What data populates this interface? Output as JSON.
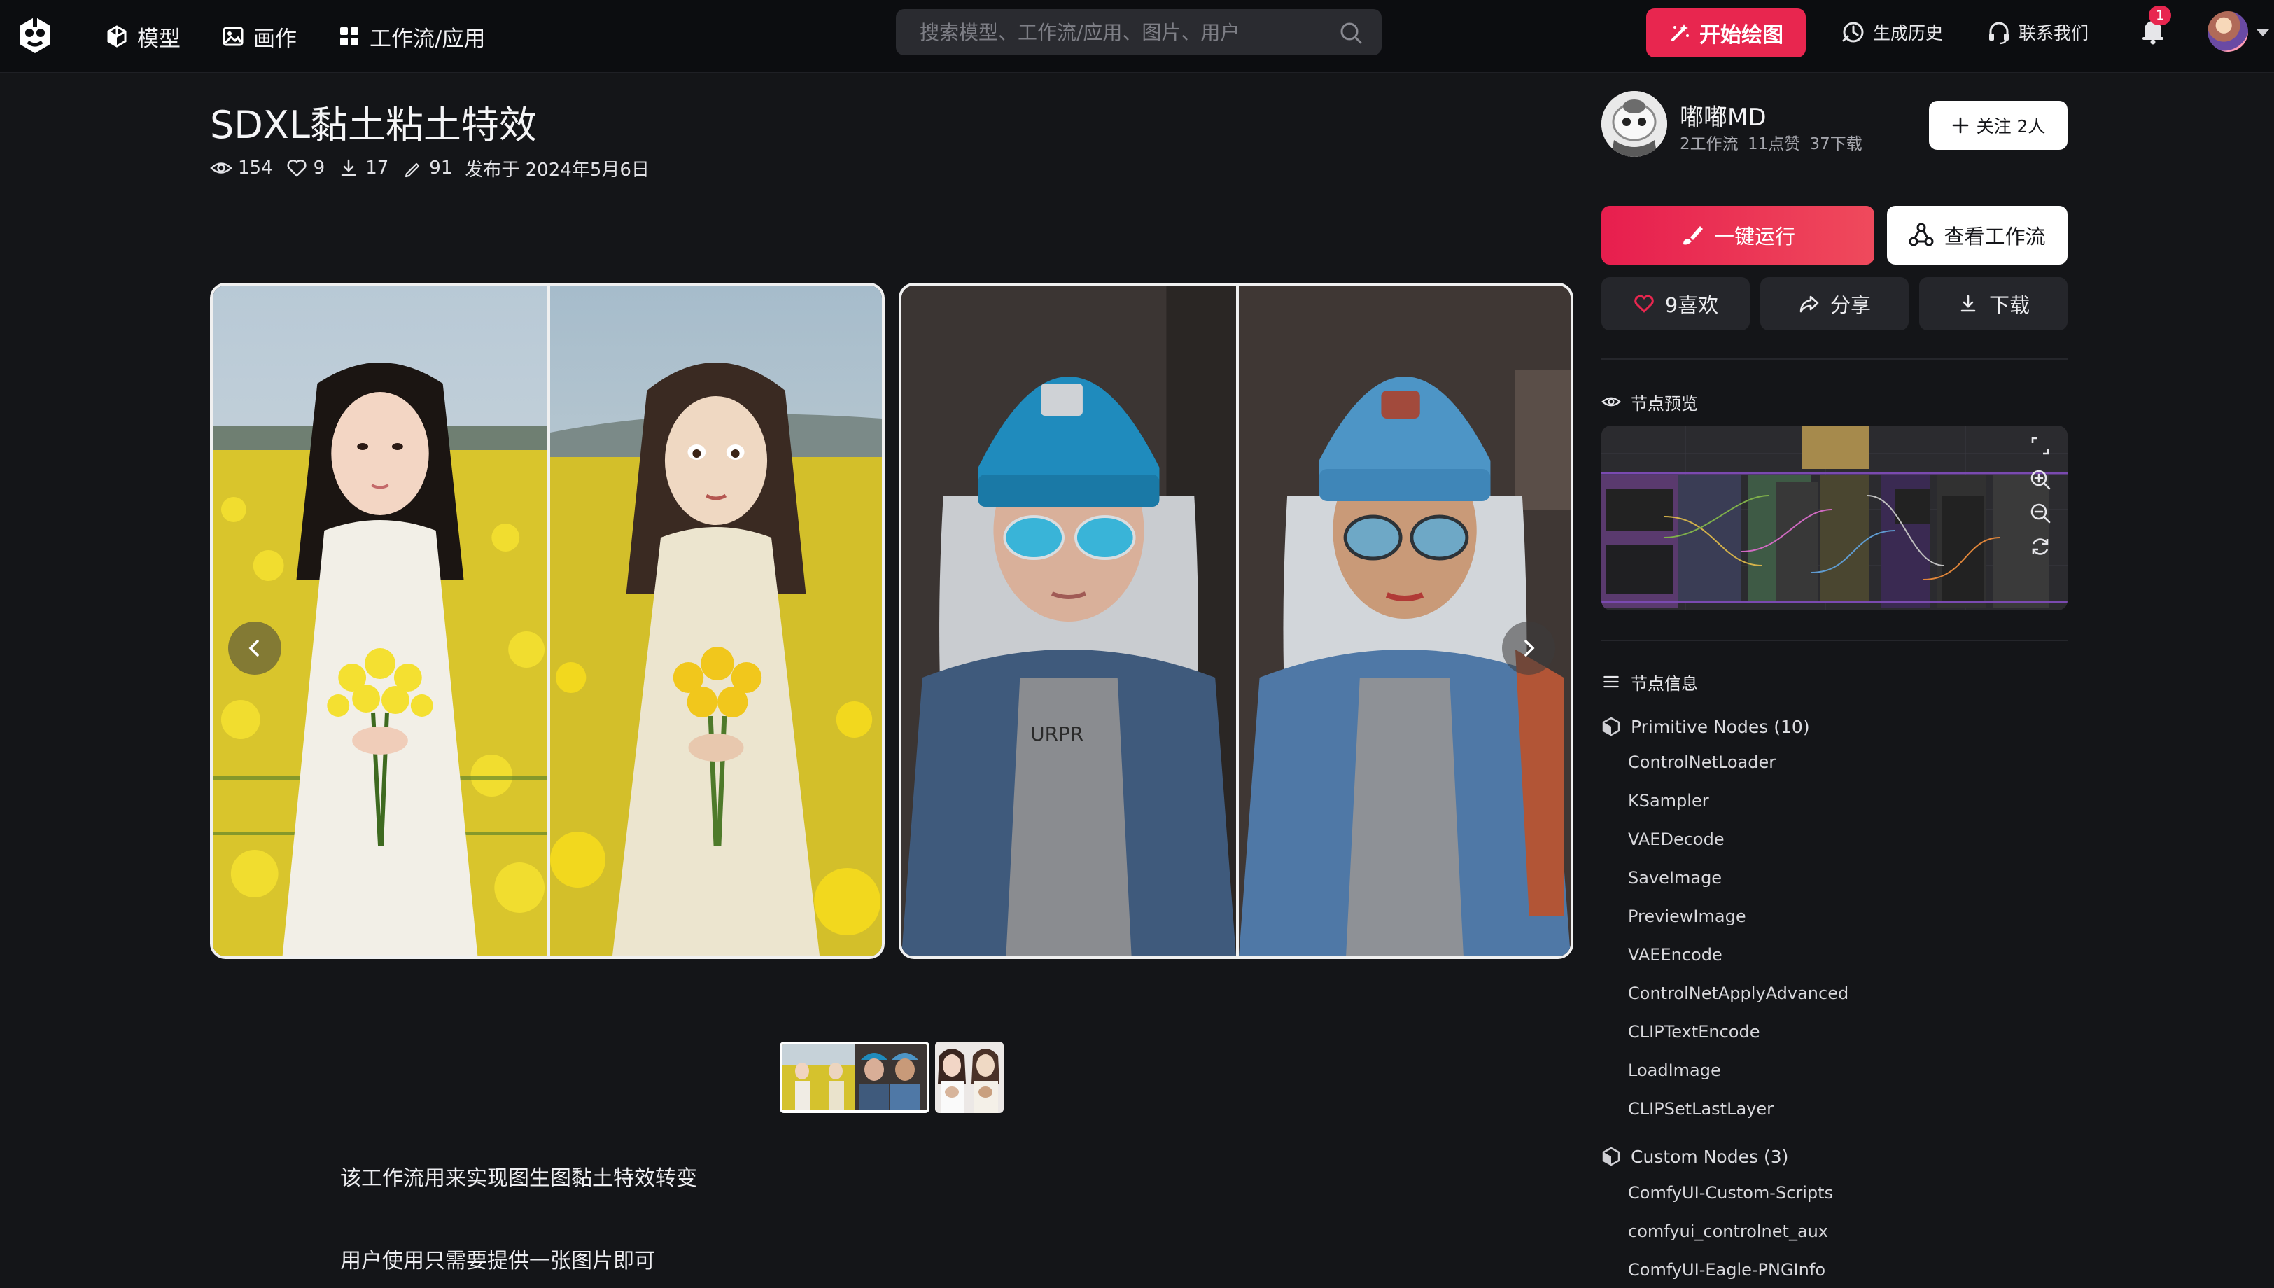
{
  "nav": {
    "items": [
      {
        "label": "模型",
        "icon": "cube-icon"
      },
      {
        "label": "画作",
        "icon": "image-icon"
      },
      {
        "label": "工作流/应用",
        "icon": "grid-icon"
      }
    ],
    "search_placeholder": "搜索模型、工作流/应用、图片、用户",
    "start_label": "开始绘图",
    "history_label": "生成历史",
    "contact_label": "联系我们",
    "notification_count": "1"
  },
  "workflow": {
    "title": "SDXL黏土粘土特效",
    "views": "154",
    "likes": "9",
    "downloads": "17",
    "runs": "91",
    "published": "发布于 2024年5月6日",
    "description": [
      "该工作流用来实现图生图黏土特效转变",
      "用户使用只需要提供一张图片即可"
    ]
  },
  "author": {
    "name": "嘟嘟MD",
    "stats": "2工作流 11点赞 37下载",
    "follow_label": "关注 2人"
  },
  "actions": {
    "run_label": "一键运行",
    "view_label": "查看工作流",
    "like_label": "9喜欢",
    "share_label": "分享",
    "download_label": "下载"
  },
  "node_preview_title": "节点预览",
  "node_info_title": "节点信息",
  "node_groups": [
    {
      "title": "Primitive Nodes (10)",
      "items": [
        "ControlNetLoader",
        "KSampler",
        "VAEDecode",
        "SaveImage",
        "PreviewImage",
        "VAEEncode",
        "ControlNetApplyAdvanced",
        "CLIPTextEncode",
        "LoadImage",
        "CLIPSetLastLayer"
      ]
    },
    {
      "title": "Custom Nodes (3)",
      "items": [
        "ComfyUI-Custom-Scripts",
        "comfyui_controlnet_aux",
        "ComfyUI-Eagle-PNGInfo"
      ]
    }
  ],
  "colors": {
    "accent": "#e8264f",
    "background": "#141518",
    "topbar": "#0c0d10"
  }
}
